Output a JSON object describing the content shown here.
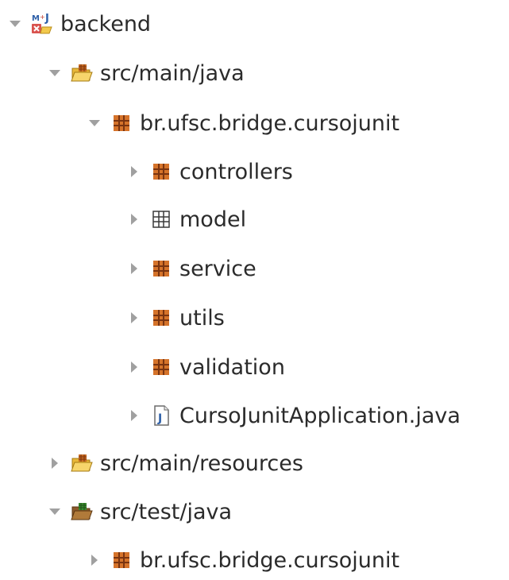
{
  "tree": {
    "items": [
      {
        "label": "backend",
        "expanded": true,
        "icon": "maven-project-icon"
      },
      {
        "label": "src/main/java",
        "expanded": true,
        "icon": "source-folder-icon"
      },
      {
        "label": "br.ufsc.bridge.cursojunit",
        "expanded": true,
        "icon": "package-icon"
      },
      {
        "label": "controllers",
        "expanded": false,
        "icon": "package-icon"
      },
      {
        "label": "model",
        "expanded": false,
        "icon": "empty-package-icon"
      },
      {
        "label": "service",
        "expanded": false,
        "icon": "package-icon"
      },
      {
        "label": "utils",
        "expanded": false,
        "icon": "package-icon"
      },
      {
        "label": "validation",
        "expanded": false,
        "icon": "package-icon"
      },
      {
        "label": "CursoJunitApplication.java",
        "expanded": false,
        "icon": "java-file-icon"
      },
      {
        "label": "src/main/resources",
        "expanded": false,
        "icon": "source-folder-icon"
      },
      {
        "label": "src/test/java",
        "expanded": true,
        "icon": "test-source-folder-icon"
      },
      {
        "label": "br.ufsc.bridge.cursojunit",
        "expanded": false,
        "icon": "package-icon"
      }
    ]
  },
  "colors": {
    "package_orange": "#c86b22",
    "package_dark": "#8a3d12",
    "folder_yellow": "#f2c94c",
    "test_folder_green": "#3b8a2f",
    "arrow_gray": "#9a9a9a",
    "java_blue": "#2d5fa8"
  }
}
